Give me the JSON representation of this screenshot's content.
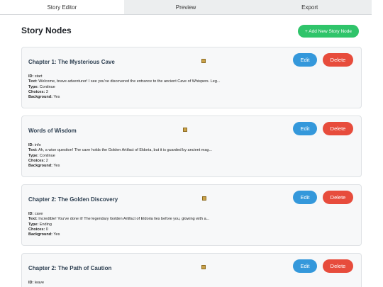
{
  "tabs": [
    {
      "label": "Story Editor",
      "active": true
    },
    {
      "label": "Preview",
      "active": false
    },
    {
      "label": "Export",
      "active": false
    }
  ],
  "header": {
    "title": "Story Nodes",
    "add_button": "+ Add New Story Node"
  },
  "labels": {
    "id": "ID:",
    "text": "Text:",
    "type": "Type:",
    "choices": "Choices:",
    "background": "Background:",
    "edit": "Edit",
    "delete": "Delete"
  },
  "nodes": [
    {
      "title": "Chapter 1: The Mysterious Cave",
      "id": "start",
      "text": "Welcome, brave adventurer! I see you've discovered the entrance to the ancient Cave of Whispers. Leg...",
      "type": "Continue",
      "choices": "3",
      "background": "Yes"
    },
    {
      "title": "Words of Wisdom",
      "id": "info",
      "text": "Ah, a wise question! The cave holds the Golden Artifact of Eldoria, but it is guarded by ancient mag...",
      "type": "Continue",
      "choices": "2",
      "background": "Yes"
    },
    {
      "title": "Chapter 2: The Golden Discovery",
      "id": "cave",
      "text": "Incredible! You've done it! The legendary Golden Artifact of Eldoria lies before you, glowing with a...",
      "type": "Ending",
      "choices": "0",
      "background": "Yes"
    },
    {
      "title": "Chapter 2: The Path of Caution",
      "id": "leave"
    }
  ]
}
